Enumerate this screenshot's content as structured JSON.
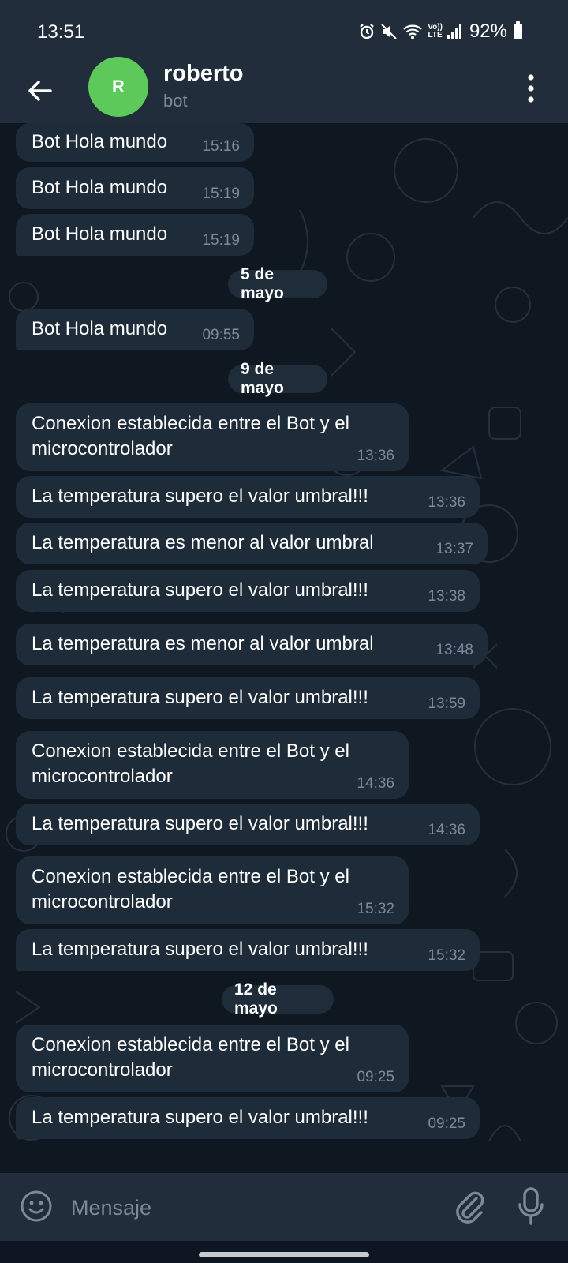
{
  "status_bar": {
    "time": "13:51",
    "battery": "92%",
    "network_label": "LTE",
    "volte_label": "Vo))"
  },
  "header": {
    "avatar_initial": "R",
    "avatar_color": "#5cc95a",
    "title": "roberto",
    "subtitle": "bot"
  },
  "messages": [
    {
      "type": "message",
      "text": "Bot Hola mundo",
      "time": "15:16"
    },
    {
      "type": "message",
      "text": "Bot Hola mundo",
      "time": "15:19"
    },
    {
      "type": "message",
      "text": "Bot Hola mundo",
      "time": "15:19"
    },
    {
      "type": "date",
      "text": "5 de mayo"
    },
    {
      "type": "message",
      "text": "Bot Hola mundo",
      "time": "09:55"
    },
    {
      "type": "date",
      "text": "9 de mayo"
    },
    {
      "type": "message",
      "text": "Conexion establecida entre el Bot y el\nmicrocontrolador",
      "time": "13:36"
    },
    {
      "type": "message",
      "text": "La temperatura supero el valor umbral!!!",
      "time": "13:36"
    },
    {
      "type": "message",
      "text": "La temperatura es menor al valor umbral",
      "time": "13:37"
    },
    {
      "type": "message",
      "text": "La temperatura supero el valor umbral!!!",
      "time": "13:38"
    },
    {
      "type": "message",
      "text": "La temperatura es menor al valor umbral",
      "time": "13:48"
    },
    {
      "type": "message",
      "text": "La temperatura supero el valor umbral!!!",
      "time": "13:59"
    },
    {
      "type": "message",
      "text": "Conexion establecida entre el Bot y el\nmicrocontrolador",
      "time": "14:36"
    },
    {
      "type": "message",
      "text": "La temperatura supero el valor umbral!!!",
      "time": "14:36"
    },
    {
      "type": "message",
      "text": "Conexion establecida entre el Bot y el\nmicrocontrolador",
      "time": "15:32"
    },
    {
      "type": "message",
      "text": "La temperatura supero el valor umbral!!!",
      "time": "15:32"
    },
    {
      "type": "date",
      "text": "12 de mayo"
    },
    {
      "type": "message",
      "text": "Conexion establecida entre el Bot y el\nmicrocontrolador",
      "time": "09:25"
    },
    {
      "type": "message",
      "text": "La temperatura supero el valor umbral!!!",
      "time": "09:25"
    }
  ],
  "composer": {
    "placeholder": "Mensaje"
  },
  "icons": {
    "back": "arrow-left-icon",
    "menu": "more-vertical-icon",
    "emoji": "smiley-icon",
    "attach": "paperclip-icon",
    "mic": "microphone-icon"
  },
  "colors": {
    "background": "#0e1621",
    "header": "#212d3b",
    "bubble": "#1e2c3a",
    "timestamp": "#7b8b9b"
  }
}
